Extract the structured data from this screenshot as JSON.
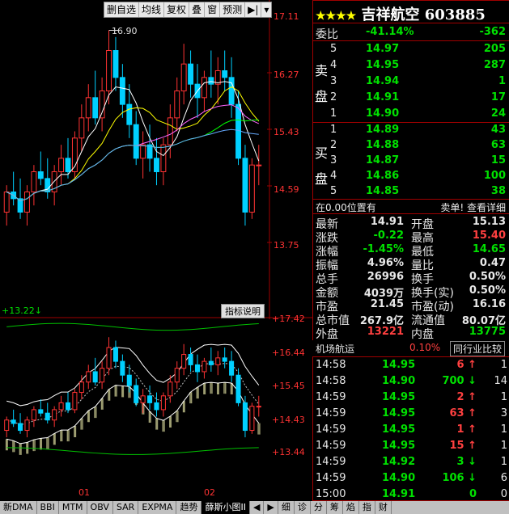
{
  "toolbar": {
    "items": [
      "删自选",
      "均线",
      "复权",
      "叠",
      "窗",
      "预测"
    ]
  },
  "main_chart": {
    "yticks": [
      "17.11",
      "16.27",
      "15.43",
      "14.59",
      "13.75"
    ],
    "max_label": "16.90",
    "candles": [
      [
        14.2,
        14.6,
        14.0,
        14.5
      ],
      [
        14.5,
        14.8,
        14.3,
        14.4
      ],
      [
        14.4,
        14.7,
        14.1,
        14.2
      ],
      [
        14.2,
        14.6,
        14.0,
        14.5
      ],
      [
        14.5,
        14.9,
        14.3,
        14.8
      ],
      [
        14.8,
        15.1,
        14.6,
        14.7
      ],
      [
        14.7,
        15.0,
        14.4,
        14.5
      ],
      [
        14.5,
        14.9,
        14.3,
        14.8
      ],
      [
        14.8,
        15.2,
        14.6,
        15.0
      ],
      [
        15.0,
        15.3,
        14.7,
        14.8
      ],
      [
        14.8,
        15.4,
        14.7,
        15.3
      ],
      [
        15.3,
        15.8,
        15.1,
        15.6
      ],
      [
        15.6,
        16.1,
        15.4,
        15.9
      ],
      [
        15.9,
        16.3,
        15.5,
        15.6
      ],
      [
        15.6,
        16.2,
        15.4,
        16.0
      ],
      [
        16.0,
        16.9,
        15.8,
        16.6
      ],
      [
        16.6,
        16.8,
        16.0,
        16.2
      ],
      [
        16.2,
        16.4,
        15.6,
        15.8
      ],
      [
        15.8,
        16.1,
        15.3,
        15.5
      ],
      [
        15.5,
        15.7,
        14.9,
        15.0
      ],
      [
        15.0,
        15.4,
        14.7,
        15.2
      ],
      [
        15.2,
        15.5,
        14.8,
        15.0
      ],
      [
        15.0,
        15.3,
        14.6,
        14.8
      ],
      [
        14.8,
        15.3,
        14.6,
        15.2
      ],
      [
        15.2,
        15.8,
        15.0,
        15.6
      ],
      [
        15.6,
        16.2,
        15.4,
        16.0
      ],
      [
        16.0,
        16.7,
        15.8,
        16.4
      ],
      [
        16.4,
        16.6,
        15.9,
        16.1
      ],
      [
        16.1,
        16.4,
        15.6,
        15.9
      ],
      [
        15.9,
        16.3,
        15.7,
        16.2
      ],
      [
        16.2,
        16.6,
        15.9,
        16.1
      ],
      [
        16.1,
        16.5,
        15.8,
        16.3
      ],
      [
        16.3,
        16.6,
        16.0,
        16.2
      ],
      [
        16.2,
        16.5,
        15.6,
        15.8
      ],
      [
        15.8,
        16.0,
        14.9,
        15.0
      ],
      [
        15.0,
        15.2,
        14.0,
        14.2
      ],
      [
        14.2,
        15.0,
        14.1,
        14.9
      ],
      [
        14.9,
        15.2,
        14.6,
        14.9
      ]
    ]
  },
  "indicator": {
    "label": "+13.22↓",
    "button": "指标说明",
    "yticks": [
      "+17.42",
      "+16.44",
      "+15.45",
      "+14.43",
      "+13.44"
    ]
  },
  "xticks": [
    "01",
    "02"
  ],
  "right": {
    "stars": "★★★★",
    "title": "吉祥航空 603885",
    "webi_label": "委比",
    "webi_pct": "-41.14%",
    "webi_val": "-362",
    "sell_label": [
      "卖",
      "盘"
    ],
    "buy_label": [
      "买",
      "盘"
    ],
    "sell": [
      {
        "n": "5",
        "p": "14.97",
        "v": "205"
      },
      {
        "n": "4",
        "p": "14.95",
        "v": "287"
      },
      {
        "n": "3",
        "p": "14.94",
        "v": "1"
      },
      {
        "n": "2",
        "p": "14.91",
        "v": "17"
      },
      {
        "n": "1",
        "p": "14.90",
        "v": "24"
      }
    ],
    "buy": [
      {
        "n": "1",
        "p": "14.89",
        "v": "43"
      },
      {
        "n": "2",
        "p": "14.88",
        "v": "63"
      },
      {
        "n": "3",
        "p": "14.87",
        "v": "15"
      },
      {
        "n": "4",
        "p": "14.86",
        "v": "100"
      },
      {
        "n": "5",
        "p": "14.85",
        "v": "38"
      }
    ],
    "position_text": "在0.00位置有",
    "position_right": "卖单! 查看详细",
    "stats": [
      {
        "l": "最新",
        "v": "14.91",
        "l2": "开盘",
        "v2": "15.13"
      },
      {
        "l": "涨跌",
        "v": "-0.22",
        "l2": "最高",
        "v2": "15.40"
      },
      {
        "l": "涨幅",
        "v": "-1.45%",
        "l2": "最低",
        "v2": "14.65"
      },
      {
        "l": "振幅",
        "v": "4.96%",
        "l2": "量比",
        "v2": "0.47"
      },
      {
        "l": "总手",
        "v": "26996",
        "l2": "换手",
        "v2": "0.50%"
      },
      {
        "l": "金额",
        "v": "4039万",
        "l2": "换手(实)",
        "v2": "0.50%"
      },
      {
        "l": "市盈",
        "v": "21.45",
        "l2": "市盈(动)",
        "v2": "16.16"
      },
      {
        "l": "总市值",
        "v": "267.9亿",
        "l2": "流通值",
        "v2": "80.07亿"
      },
      {
        "l": "外盘",
        "v": "13221",
        "l2": "内盘",
        "v2": "13775"
      }
    ],
    "industry_name": "机场航运",
    "industry_pct": "0.10%",
    "industry_btn": "同行业比较",
    "ticks": [
      {
        "t": "14:58",
        "p": "14.95",
        "v": "6",
        "d": "up",
        "x": "1"
      },
      {
        "t": "14:58",
        "p": "14.90",
        "v": "700",
        "d": "down",
        "x": "14"
      },
      {
        "t": "14:59",
        "p": "14.95",
        "v": "2",
        "d": "up",
        "x": "1"
      },
      {
        "t": "14:59",
        "p": "14.95",
        "v": "63",
        "d": "up",
        "x": "3"
      },
      {
        "t": "14:59",
        "p": "14.95",
        "v": "1",
        "d": "up",
        "x": "1"
      },
      {
        "t": "14:59",
        "p": "14.95",
        "v": "15",
        "d": "up",
        "x": "1"
      },
      {
        "t": "14:59",
        "p": "14.92",
        "v": "3",
        "d": "down",
        "x": "1"
      },
      {
        "t": "14:59",
        "p": "14.90",
        "v": "106",
        "d": "down",
        "x": "6"
      },
      {
        "t": "15:00",
        "p": "14.91",
        "v": "0",
        "d": "none",
        "x": "0"
      }
    ]
  },
  "bottom_tabs": [
    "新DMA",
    "BBI",
    "MTM",
    "OBV",
    "SAR",
    "EXPMA",
    "趋势",
    "薛斯小图II"
  ],
  "bottom_right_tabs": [
    "细",
    "诊",
    "分",
    "筹",
    "焰",
    "指",
    "财"
  ],
  "colors": {
    "up": "#ff3333",
    "down": "#00d0ff",
    "bg": "#000000",
    "grid": "#a00000"
  }
}
